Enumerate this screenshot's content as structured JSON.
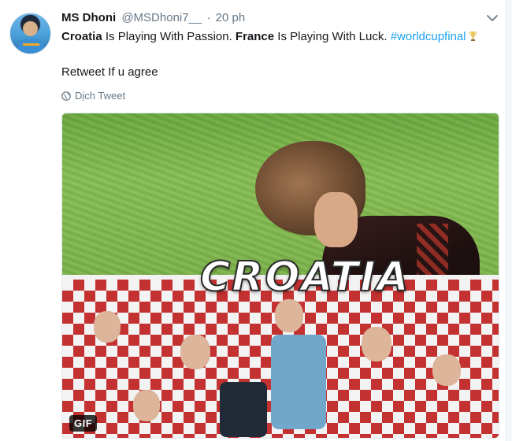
{
  "tweet": {
    "author_name": "MS Dhoni",
    "author_handle": "@MSDhoni7__",
    "separator": "·",
    "time": "20 ph",
    "text_part1": "Croatia",
    "text_part2": " Is Playing With Passion. ",
    "text_part3": "France",
    "text_part4": " Is Playing With Luck. ",
    "hashtag": "#worldcupfinal",
    "text_line2": "Retweet If u agree",
    "translate_label": "Dịch Tweet",
    "media_overlay_text": "CROATIA",
    "media_badge": "GIF"
  },
  "icons": {
    "caret": "chevron-down-icon",
    "globe": "globe-icon",
    "trophy": "trophy-icon"
  },
  "colors": {
    "link": "#1da1f2",
    "secondary_text": "#657786",
    "primary_text": "#14171a"
  }
}
